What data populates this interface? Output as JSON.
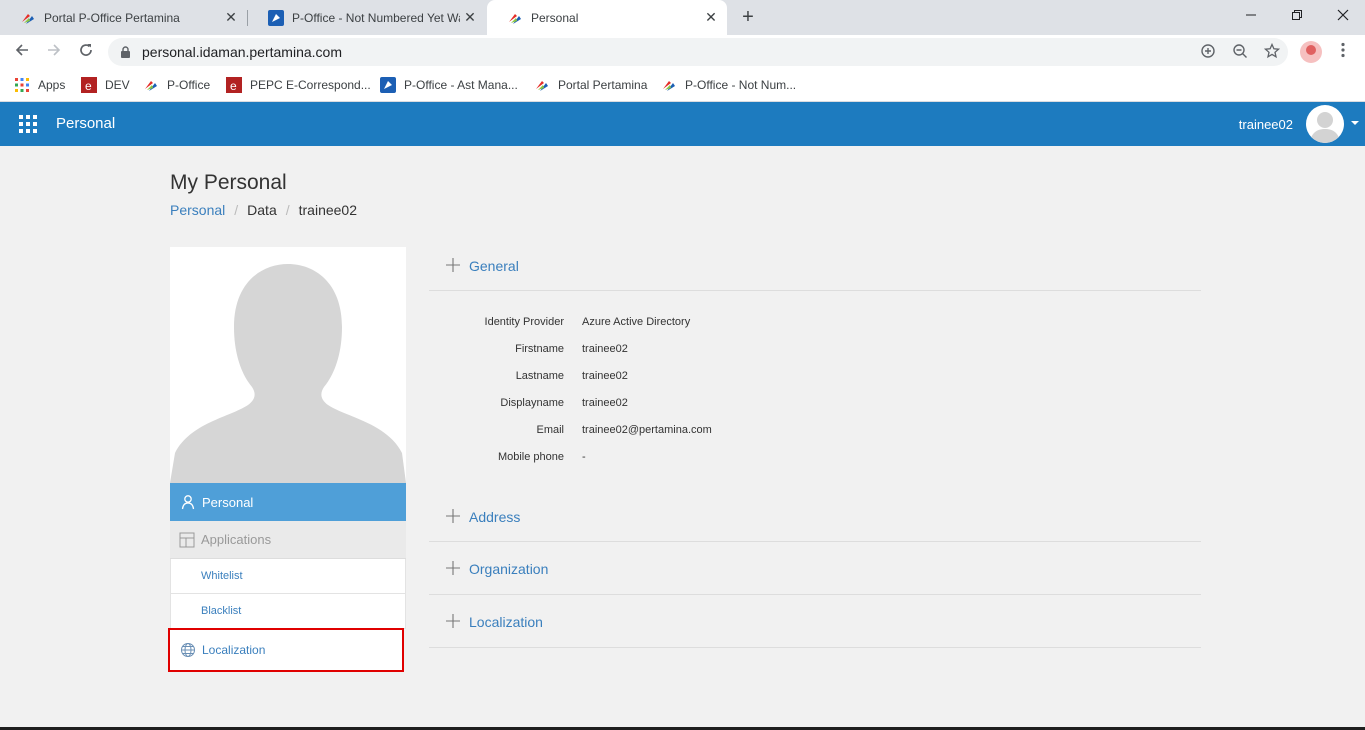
{
  "browser": {
    "tabs": [
      {
        "title": "Portal P-Office Pertamina",
        "favicon": "pertamina-logo-icon",
        "active": false
      },
      {
        "title": "P-Office - Not Numbered Yet Wa",
        "favicon": "p-office-icon",
        "active": false
      },
      {
        "title": "Personal",
        "favicon": "pertamina-logo-icon",
        "active": true
      }
    ],
    "close_glyph": "✕",
    "new_tab_glyph": "+",
    "url": "personal.idaman.pertamina.com",
    "bookmarks": [
      {
        "label": "Apps",
        "icon": "apps-grid-icon"
      },
      {
        "label": "DEV",
        "icon": "e-icon"
      },
      {
        "label": "P-Office",
        "icon": "pertamina-logo-icon"
      },
      {
        "label": "PEPC E-Correspond...",
        "icon": "e-icon"
      },
      {
        "label": "P-Office - Ast Mana...",
        "icon": "p-office-icon"
      },
      {
        "label": "Portal Pertamina",
        "icon": "pertamina-logo-icon"
      },
      {
        "label": "P-Office - Not Num...",
        "icon": "pertamina-logo-icon"
      }
    ]
  },
  "app": {
    "name": "Personal",
    "username": "trainee02",
    "header_color": "#1d7bbf"
  },
  "page": {
    "title": "My Personal",
    "breadcrumb": [
      "Personal",
      "Data",
      "trainee02"
    ]
  },
  "sidebar": {
    "personal_label": "Personal",
    "applications_label": "Applications",
    "whitelist_label": "Whitelist",
    "blacklist_label": "Blacklist",
    "localization_label": "Localization"
  },
  "sections": {
    "general": "General",
    "address": "Address",
    "organization": "Organization",
    "localization": "Localization"
  },
  "general_fields": [
    {
      "key": "Identity Provider",
      "value": "Azure Active Directory"
    },
    {
      "key": "Firstname",
      "value": "trainee02"
    },
    {
      "key": "Lastname",
      "value": "trainee02"
    },
    {
      "key": "Displayname",
      "value": "trainee02"
    },
    {
      "key": "Email",
      "value": "trainee02@pertamina.com"
    },
    {
      "key": "Mobile phone",
      "value": "-"
    }
  ],
  "colors": {
    "link": "#3a7fbd",
    "sidebar_active": "#4f9fd8",
    "highlight_border": "#e00000"
  }
}
